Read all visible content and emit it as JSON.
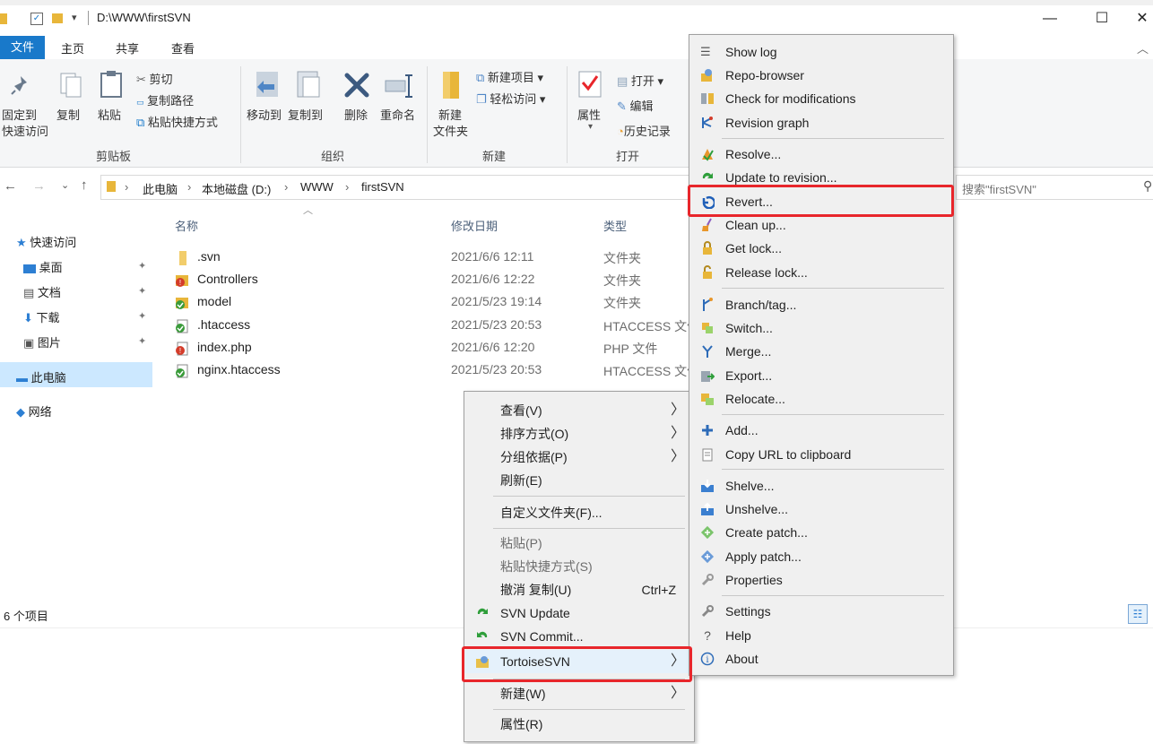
{
  "window": {
    "path": "D:\\WWW\\firstSVN",
    "min_glyph": "—",
    "max_glyph": "☐",
    "close_glyph": "✕"
  },
  "ribbon": {
    "tabs": [
      "文件",
      "主页",
      "共享",
      "查看"
    ],
    "clipboard": {
      "pin_line1": "固定到",
      "pin_line2": "快速访问",
      "copy": "复制",
      "paste": "粘贴",
      "cut": "剪切",
      "copy_path": "复制路径",
      "paste_shortcut": "粘贴快捷方式",
      "group": "剪贴板"
    },
    "organize": {
      "move_to": "移动到",
      "copy_to": "复制到",
      "delete": "删除",
      "rename": "重命名",
      "group": "组织"
    },
    "new": {
      "new_item": "新建项目 ▾",
      "easy_access": "轻松访问 ▾",
      "new_folder_1": "新建",
      "new_folder_2": "文件夹",
      "group": "新建"
    },
    "open": {
      "properties": "属性",
      "open": "打开 ▾",
      "edit": "编辑",
      "history": "历史记录",
      "group": "打开"
    }
  },
  "address": {
    "crumbs": [
      "此电脑",
      "本地磁盘 (D:)",
      "WWW",
      "firstSVN"
    ],
    "search_placeholder": "搜索\"firstSVN\""
  },
  "nav": {
    "quick_access": "快速访问",
    "desktop": "桌面",
    "documents": "文档",
    "downloads": "下载",
    "pictures": "图片",
    "this_pc": "此电脑",
    "network": "网络"
  },
  "files": {
    "columns": [
      "名称",
      "修改日期",
      "类型"
    ],
    "rows": [
      {
        "name": ".svn",
        "date": "2021/6/6 12:11",
        "type": "文件夹"
      },
      {
        "name": "Controllers",
        "date": "2021/6/6 12:22",
        "type": "文件夹"
      },
      {
        "name": "model",
        "date": "2021/5/23 19:14",
        "type": "文件夹"
      },
      {
        "name": ".htaccess",
        "date": "2021/5/23 20:53",
        "type": "HTACCESS 文件"
      },
      {
        "name": "index.php",
        "date": "2021/6/6 12:20",
        "type": "PHP 文件"
      },
      {
        "name": "nginx.htaccess",
        "date": "2021/5/23 20:53",
        "type": "HTACCESS 文件"
      }
    ]
  },
  "status": {
    "count": "6 个项目"
  },
  "context_menu": {
    "view": "查看(V)",
    "sort": "排序方式(O)",
    "group": "分组依据(P)",
    "refresh": "刷新(E)",
    "customize": "自定义文件夹(F)...",
    "paste": "粘贴(P)",
    "paste_shortcut": "粘贴快捷方式(S)",
    "undo": "撤消 复制(U)",
    "undo_shortcut": "Ctrl+Z",
    "svn_update": "SVN Update",
    "svn_commit": "SVN Commit...",
    "tortoise": "TortoiseSVN",
    "new": "新建(W)",
    "properties": "属性(R)",
    "arrow": "〉"
  },
  "svn_menu": {
    "show_log": "Show log",
    "repo_browser": "Repo-browser",
    "check_mods": "Check for modifications",
    "rev_graph": "Revision graph",
    "resolve": "Resolve...",
    "update_rev": "Update to revision...",
    "revert": "Revert...",
    "clean_up": "Clean up...",
    "get_lock": "Get lock...",
    "release_lock": "Release lock...",
    "branch_tag": "Branch/tag...",
    "switch": "Switch...",
    "merge": "Merge...",
    "export": "Export...",
    "relocate": "Relocate...",
    "add": "Add...",
    "copy_url": "Copy URL to clipboard",
    "shelve": "Shelve...",
    "unshelve": "Unshelve...",
    "create_patch": "Create patch...",
    "apply_patch": "Apply patch...",
    "properties": "Properties",
    "settings": "Settings",
    "help": "Help",
    "about": "About"
  },
  "colors": {
    "accent": "#1979ca",
    "highlight": "#e8262b",
    "menu_bg": "#f0f0f0"
  }
}
